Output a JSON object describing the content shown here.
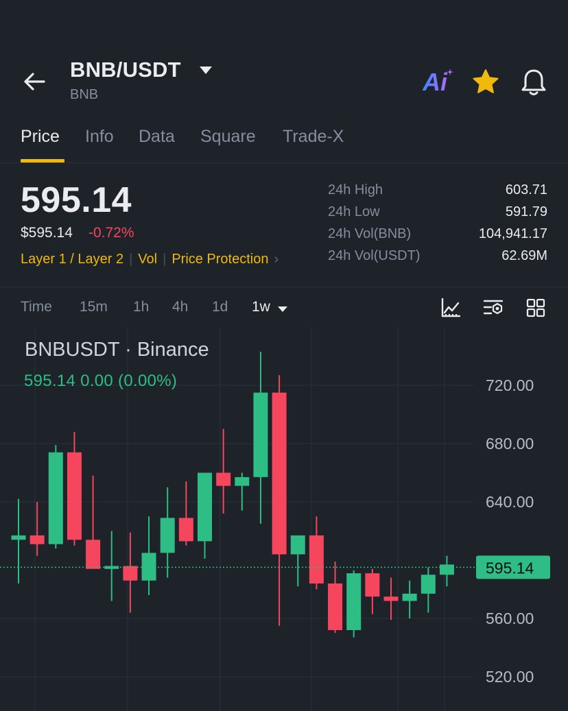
{
  "header": {
    "pair": "BNB/USDT",
    "subtitle": "BNB",
    "ai_label": "Ai"
  },
  "tabs": [
    {
      "label": "Price",
      "active": true
    },
    {
      "label": "Info",
      "active": false
    },
    {
      "label": "Data",
      "active": false
    },
    {
      "label": "Square",
      "active": false
    },
    {
      "label": "Trade-X",
      "active": false
    }
  ],
  "price": {
    "last": "595.14",
    "usd": "$595.14",
    "change": "-0.72%"
  },
  "tags": {
    "category": "Layer 1 / Layer 2",
    "vol": "Vol",
    "protection": "Price Protection"
  },
  "stats": [
    {
      "label": "24h High",
      "value": "603.71"
    },
    {
      "label": "24h Low",
      "value": "591.79"
    },
    {
      "label": "24h Vol(BNB)",
      "value": "104,941.17"
    },
    {
      "label": "24h Vol(USDT)",
      "value": "62.69M"
    }
  ],
  "timeframes": {
    "time": "Time",
    "m15": "15m",
    "h1": "1h",
    "h4": "4h",
    "d1": "1d",
    "w1": "1w",
    "selected": "1w"
  },
  "chart_meta": {
    "title": "BNBUSDT · Binance",
    "ohlc_line": "595.14  0.00 (0.00%)",
    "current_price_label": "595.14"
  },
  "colors": {
    "background": "#1e2329",
    "up": "#2ebd85",
    "down": "#f6465d",
    "accent": "#f0b90b",
    "text_primary": "#eaecef",
    "text_secondary": "#848e9c"
  },
  "chart_data": {
    "type": "candlestick",
    "y_ticks": [
      "720.00",
      "680.00",
      "640.00",
      "560.00",
      "520.00"
    ],
    "ylim": [
      510,
      745
    ],
    "current_price": 595.14,
    "candles": [
      {
        "o": 614,
        "h": 642,
        "l": 584,
        "c": 617
      },
      {
        "o": 617,
        "h": 640,
        "l": 603,
        "c": 611
      },
      {
        "o": 611,
        "h": 679,
        "l": 608,
        "c": 674
      },
      {
        "o": 674,
        "h": 688,
        "l": 610,
        "c": 614
      },
      {
        "o": 614,
        "h": 658,
        "l": 596,
        "c": 594
      },
      {
        "o": 594,
        "h": 620,
        "l": 572,
        "c": 596
      },
      {
        "o": 596,
        "h": 619,
        "l": 564,
        "c": 586
      },
      {
        "o": 586,
        "h": 630,
        "l": 576,
        "c": 605
      },
      {
        "o": 605,
        "h": 650,
        "l": 588,
        "c": 629
      },
      {
        "o": 629,
        "h": 654,
        "l": 610,
        "c": 613
      },
      {
        "o": 613,
        "h": 659,
        "l": 601,
        "c": 660
      },
      {
        "o": 660,
        "h": 690,
        "l": 632,
        "c": 651
      },
      {
        "o": 651,
        "h": 660,
        "l": 634,
        "c": 657
      },
      {
        "o": 657,
        "h": 743,
        "l": 625,
        "c": 715
      },
      {
        "o": 715,
        "h": 727,
        "l": 555,
        "c": 604
      },
      {
        "o": 604,
        "h": 615,
        "l": 582,
        "c": 617
      },
      {
        "o": 617,
        "h": 630,
        "l": 580,
        "c": 584
      },
      {
        "o": 584,
        "h": 599,
        "l": 550,
        "c": 552
      },
      {
        "o": 552,
        "h": 593,
        "l": 547,
        "c": 591
      },
      {
        "o": 591,
        "h": 594,
        "l": 563,
        "c": 575
      },
      {
        "o": 575,
        "h": 588,
        "l": 559,
        "c": 572
      },
      {
        "o": 572,
        "h": 586,
        "l": 560,
        "c": 577
      },
      {
        "o": 577,
        "h": 595,
        "l": 564,
        "c": 590
      },
      {
        "o": 590,
        "h": 603,
        "l": 582,
        "c": 597
      }
    ]
  }
}
